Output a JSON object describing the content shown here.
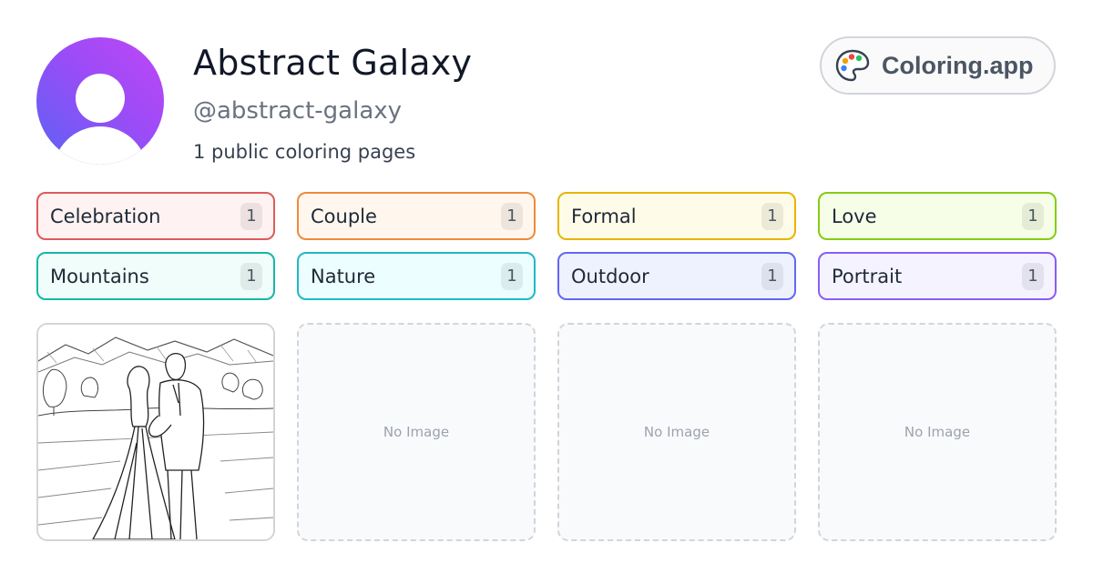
{
  "profile": {
    "name": "Abstract Galaxy",
    "handle": "@abstract-galaxy",
    "page_count_text": "1 public coloring pages"
  },
  "brand": {
    "label": "Coloring.app",
    "icon": "palette-icon"
  },
  "tags": [
    {
      "label": "Celebration",
      "count": "1",
      "border": "#e05a5a",
      "bg": "#fef2f2"
    },
    {
      "label": "Couple",
      "count": "1",
      "border": "#f08a3c",
      "bg": "#fff7ed"
    },
    {
      "label": "Formal",
      "count": "1",
      "border": "#eab308",
      "bg": "#fefce8"
    },
    {
      "label": "Love",
      "count": "1",
      "border": "#84cc16",
      "bg": "#f7fee7"
    },
    {
      "label": "Mountains",
      "count": "1",
      "border": "#14b8a6",
      "bg": "#f0fdfa"
    },
    {
      "label": "Nature",
      "count": "1",
      "border": "#22b8c5",
      "bg": "#ecfeff"
    },
    {
      "label": "Outdoor",
      "count": "1",
      "border": "#6366f1",
      "bg": "#eef2ff"
    },
    {
      "label": "Portrait",
      "count": "1",
      "border": "#8b5cf6",
      "bg": "#f5f3ff"
    }
  ],
  "cards": [
    {
      "type": "image",
      "subject": "wedding couple line-art coloring page"
    },
    {
      "type": "empty",
      "label": "No Image"
    },
    {
      "type": "empty",
      "label": "No Image"
    },
    {
      "type": "empty",
      "label": "No Image"
    }
  ]
}
